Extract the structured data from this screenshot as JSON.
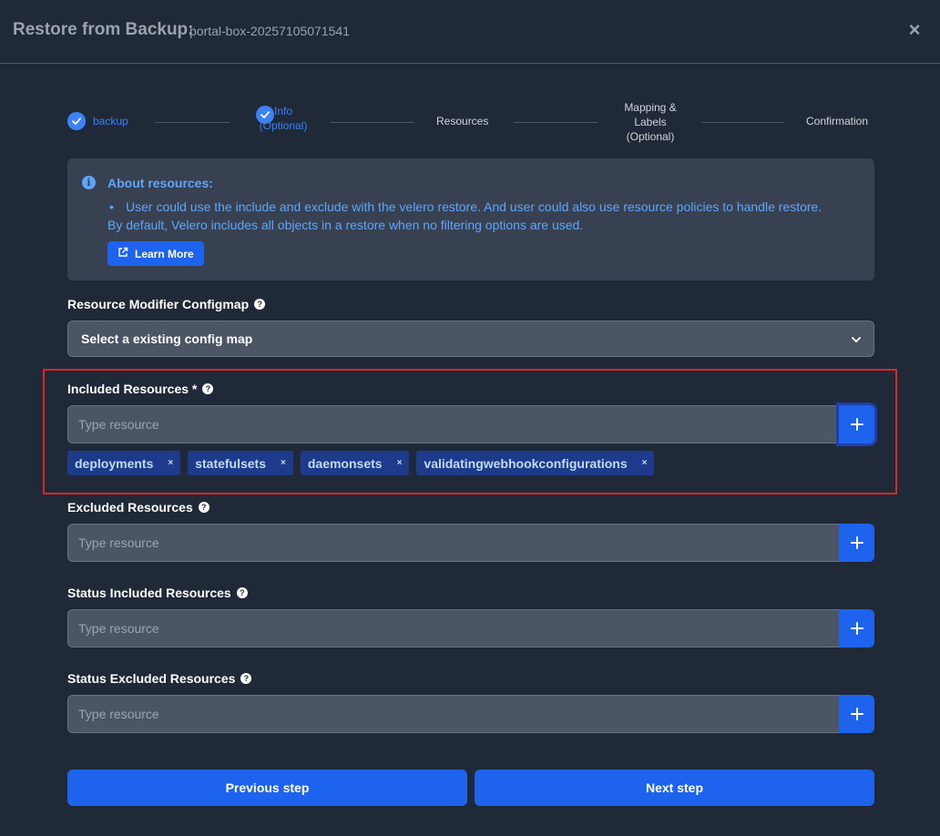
{
  "header": {
    "title": "Restore from Backup:",
    "backup_name": "portal-box-20257105071541",
    "close_icon": "×"
  },
  "stepper": {
    "steps": [
      {
        "label": "backup",
        "done": true
      },
      {
        "label": "Info\n(Optional)",
        "done": true
      },
      {
        "label": "Resources",
        "done": false
      },
      {
        "label": "Mapping &\nLabels\n(Optional)",
        "done": false
      },
      {
        "label": "Confirmation",
        "done": false
      }
    ]
  },
  "info": {
    "title": "About resources:",
    "text_line1": "User could use the include and exclude with the velero restore. And user could also use resource policies to handle restore.",
    "text_line2": "By default, Velero includes all objects in a restore when no filtering options are used.",
    "learn_more": "Learn More"
  },
  "modifier": {
    "label": "Resource Modifier Configmap",
    "selected": "Select a existing config map"
  },
  "included": {
    "label": "Included Resources *",
    "placeholder": "Type resource",
    "chips": [
      "deployments",
      "statefulsets",
      "daemonsets",
      "validatingwebhookconfigurations"
    ]
  },
  "excluded": {
    "label": "Excluded Resources",
    "placeholder": "Type resource"
  },
  "status_included": {
    "label": "Status Included Resources",
    "placeholder": "Type resource"
  },
  "status_excluded": {
    "label": "Status Excluded Resources",
    "placeholder": "Type resource"
  },
  "footer": {
    "previous": "Previous step",
    "next": "Next step"
  },
  "colors": {
    "accent": "#1d63ed",
    "highlight": "#dc2626",
    "info_text": "#60a5fa"
  }
}
